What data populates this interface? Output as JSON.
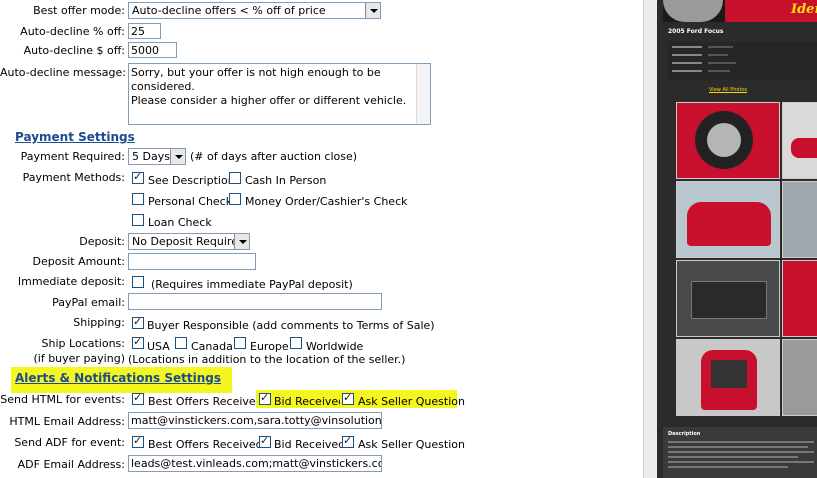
{
  "offer": {
    "best_offer_mode_label": "Best offer mode:",
    "best_offer_mode_value": "Auto-decline offers < % off of price",
    "decline_pct_label": "Auto-decline % off:",
    "decline_pct_value": "25",
    "decline_dollar_label": "Auto-decline $ off:",
    "decline_dollar_value": "5000",
    "decline_msg_label": "Auto-decline message:",
    "decline_msg_line1": "Sorry, but your offer is not high enough to be considered.",
    "decline_msg_line2": "Please consider a higher offer or different vehicle."
  },
  "payment": {
    "section_title": "Payment Settings",
    "required_label": "Payment Required:",
    "required_value": "5 Days",
    "required_note": "(# of days after auction close)",
    "methods_label": "Payment Methods:",
    "methods": [
      {
        "label": "See Description",
        "checked": true
      },
      {
        "label": "Cash In Person",
        "checked": false
      },
      {
        "label": "Personal Check",
        "checked": false
      },
      {
        "label": "Money Order/Cashier's Check",
        "checked": false
      },
      {
        "label": "Loan Check",
        "checked": false
      }
    ],
    "deposit_label": "Deposit:",
    "deposit_value": "No Deposit Required",
    "deposit_amount_label": "Deposit Amount:",
    "deposit_amount_value": "",
    "immediate_label": "Immediate deposit:",
    "immediate_note": "(Requires immediate PayPal deposit)",
    "paypal_label": "PayPal email:",
    "paypal_value": "",
    "shipping_label": "Shipping:",
    "shipping_option": "Buyer Responsible (add comments to Terms of Sale)",
    "ship_loc_label": "Ship Locations:",
    "ship_loc_sublabel": "(if buyer paying)",
    "ship_locations": [
      {
        "label": "USA",
        "checked": true
      },
      {
        "label": "Canada",
        "checked": false
      },
      {
        "label": "Europe",
        "checked": false
      },
      {
        "label": "Worldwide",
        "checked": false
      }
    ],
    "ship_loc_note": "(Locations in addition to the location of the seller.)"
  },
  "alerts": {
    "section_title": "Alerts & Notifications Settings",
    "html_events_label": "Send HTML for events:",
    "html_events": [
      {
        "label": "Best Offers Received",
        "checked": true
      },
      {
        "label": "Bid Received",
        "checked": true
      },
      {
        "label": "Ask Seller Question",
        "checked": true
      }
    ],
    "html_email_label": "HTML Email Address:",
    "html_email_value": "matt@vinstickers.com,sara.totty@vinsolutions.com,t",
    "adf_events_label": "Send ADF for event:",
    "adf_events": [
      {
        "label": "Best Offers Received",
        "checked": true
      },
      {
        "label": "Bid Received",
        "checked": true
      },
      {
        "label": "Ask Seller Question",
        "checked": true
      }
    ],
    "adf_email_label": "ADF Email Address:",
    "adf_email_value": "leads@test.vinleads.com;matt@vinstickers.com"
  },
  "preview": {
    "banner_text": "Iden",
    "car_title": "2005 Ford Focus",
    "view_all": "View All Photos",
    "description_heading": "Description",
    "highlight_color": "#f5f520",
    "accent_red": "#c8102e"
  }
}
